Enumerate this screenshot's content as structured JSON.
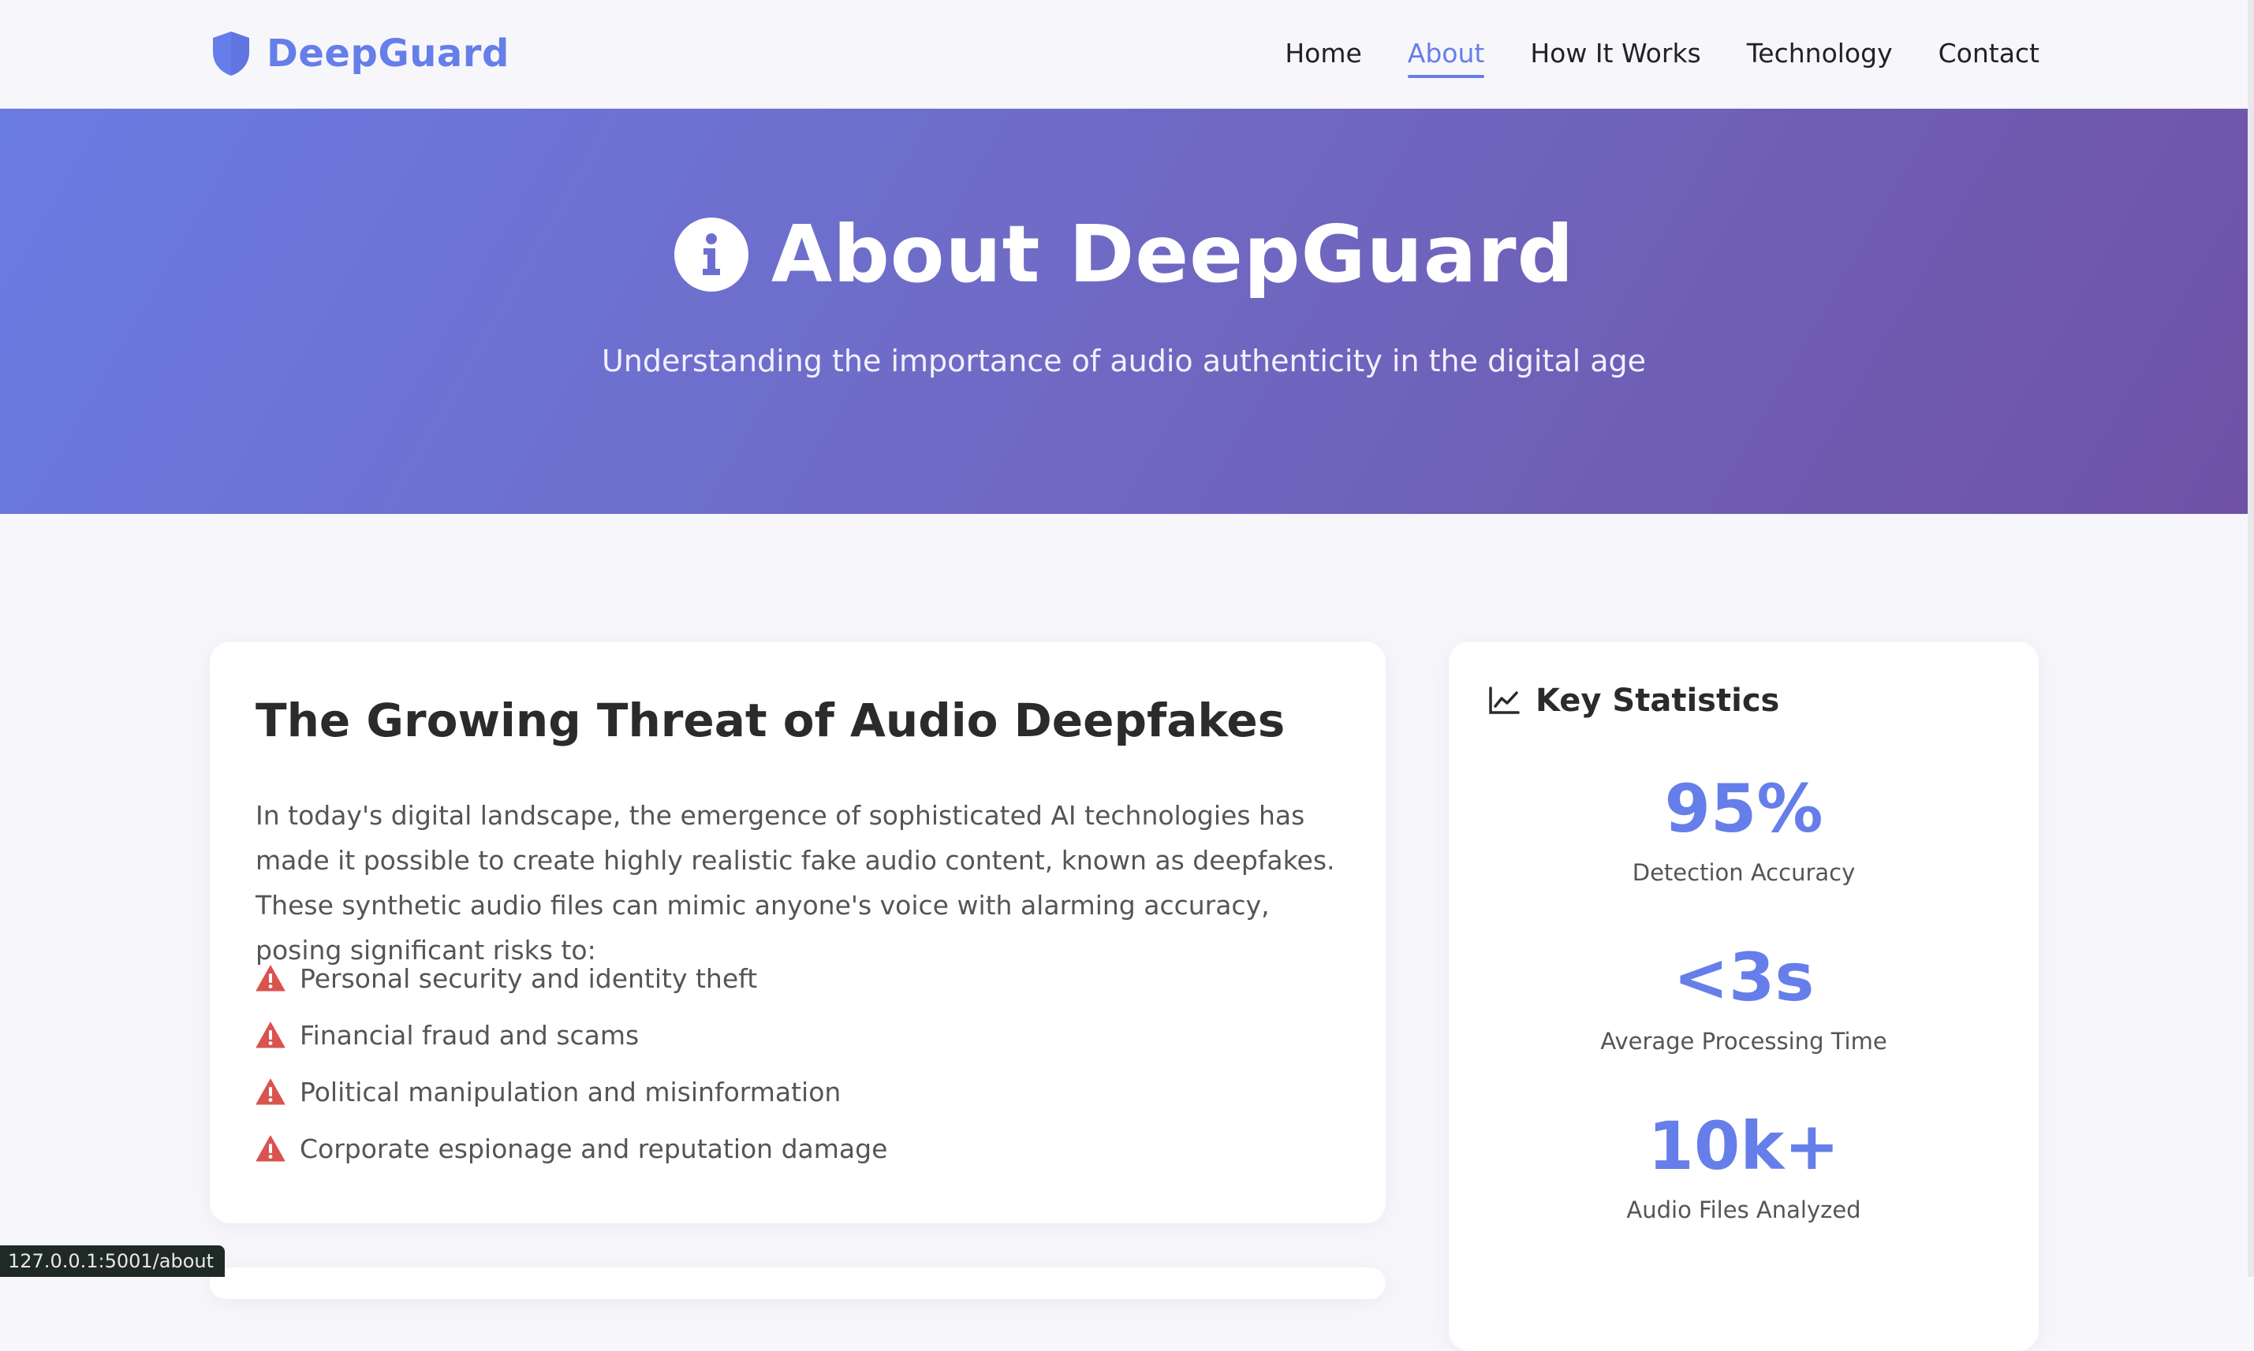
{
  "brand": {
    "name": "DeepGuard",
    "icon": "shield-icon",
    "color": "#667eea"
  },
  "nav": {
    "items": [
      {
        "label": "Home",
        "active": false
      },
      {
        "label": "About",
        "active": true
      },
      {
        "label": "How It Works",
        "active": false
      },
      {
        "label": "Technology",
        "active": false
      },
      {
        "label": "Contact",
        "active": false
      }
    ]
  },
  "hero": {
    "icon": "info-circle-icon",
    "title": "About DeepGuard",
    "subtitle": "Understanding the importance of audio authenticity in the digital age",
    "gradient": [
      "#6a7be3",
      "#6f52a6"
    ]
  },
  "threat": {
    "title": "The Growing Threat of Audio Deepfakes",
    "body": "In today's digital landscape, the emergence of sophisticated AI technologies has made it possible to create highly realistic fake audio content, known as deepfakes. These synthetic audio files can mimic anyone's voice with alarming accuracy, posing significant risks to:",
    "risk_icon": "warning-triangle-icon",
    "risk_color": "#d9534f",
    "risks": [
      "Personal security and identity theft",
      "Financial fraud and scams",
      "Political manipulation and misinformation",
      "Corporate espionage and reputation damage"
    ]
  },
  "stats": {
    "icon": "line-chart-icon",
    "title": "Key Statistics",
    "items": [
      {
        "value": "95%",
        "label": "Detection Accuracy"
      },
      {
        "value": "<3s",
        "label": "Average Processing Time"
      },
      {
        "value": "10k+",
        "label": "Audio Files Analyzed"
      }
    ]
  },
  "status_bar": {
    "url": "127.0.0.1:5001/about"
  }
}
